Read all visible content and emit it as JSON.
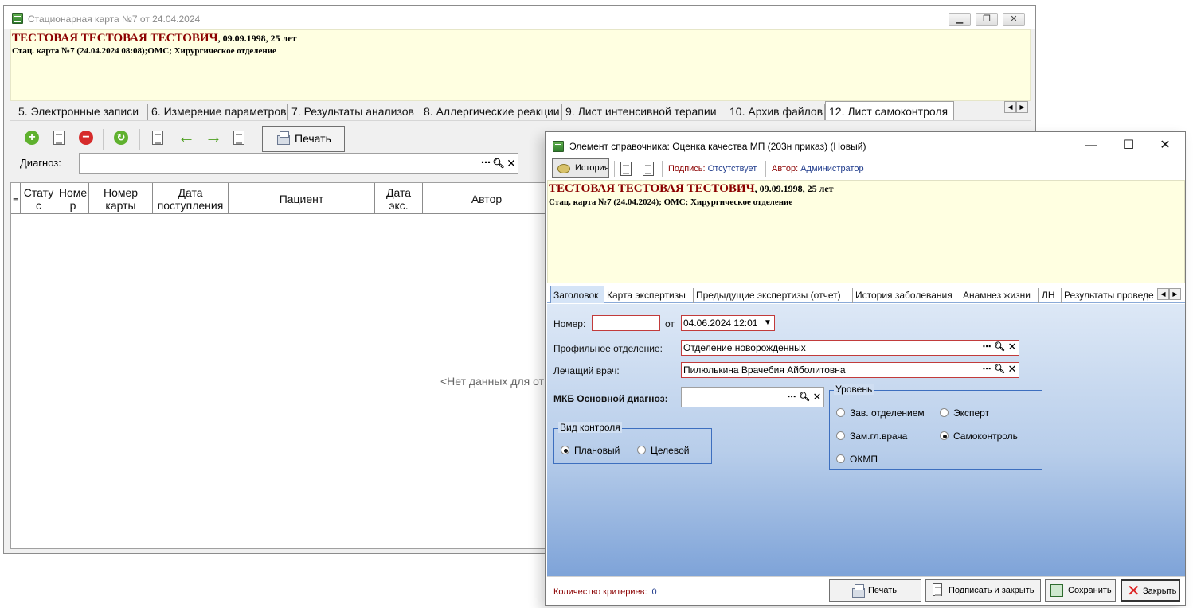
{
  "back": {
    "title": "Стационарная карта №7 от 24.04.2024",
    "patient": {
      "name": "ТЕСТОВАЯ ТЕСТОВАЯ ТЕСТОВИЧ",
      "info": ", 09.09.1998, 25 лет",
      "line2": "Стац. карта №7 (24.04.2024 08:08);ОМС; Хирургическое отделение"
    },
    "tabs": [
      "5. Электронные записи",
      "6. Измерение параметров",
      "7. Результаты анализов",
      "8. Аллергические реакции",
      "9. Лист интенсивной терапии",
      "10. Архив файлов",
      "12. Лист самоконтроля"
    ],
    "print_label": "Печать",
    "diagnosis_label": "Диагноз:",
    "grid_columns": [
      "Стату с",
      "Номе р",
      "Номер карты",
      "Дата поступления",
      "Пациент",
      "Дата экс.",
      "Автор"
    ],
    "empty_text": "<Нет данных для от"
  },
  "dialog": {
    "title": "Элемент справочника: Оценка качества МП (203н приказ) (Новый)",
    "history_label": "История",
    "signature_label": "Подпись:",
    "signature_value": "Отсутствует",
    "author_label": "Автор:",
    "author_value": "Администратор",
    "patient": {
      "name": "ТЕСТОВАЯ ТЕСТОВАЯ ТЕСТОВИЧ",
      "info": ", 09.09.1998, 25 лет",
      "line2": "Стац. карта №7 (24.04.2024); ОМС; Хирургическое отделение"
    },
    "tabs": [
      "Заголовок",
      "Карта экспертизы",
      "Предыдущие экспертизы (отчет)",
      "История заболевания",
      "Анамнез жизни",
      "ЛН",
      "Результаты проведе"
    ],
    "form": {
      "number_label": "Номер:",
      "number_value": "",
      "from_label": "от",
      "date_value": "04.06.2024 12:01",
      "department_label": "Профильное отделение:",
      "department_value": "Отделение новорожденных",
      "doctor_label": "Лечащий врач:",
      "doctor_value": "Пилюлькина Врачебия Айболитовна",
      "mkb_label": "МКБ Основной диагноз:",
      "mkb_value": "",
      "control_group": "Вид контроля",
      "control_options": [
        "Плановый",
        "Целевой"
      ],
      "control_selected": "Плановый",
      "level_group": "Уровень",
      "level_options": [
        "Зав. отделением",
        "Эксперт",
        "Зам.гл.врача",
        "Самоконтроль",
        "ОКМП"
      ],
      "level_selected": "Самоконтроль"
    },
    "footer": {
      "criteria_label": "Количество критериев:",
      "criteria_value": "0",
      "print": "Печать",
      "sign_close": "Подписать и закрыть",
      "save": "Сохранить",
      "close": "Закрыть"
    }
  }
}
